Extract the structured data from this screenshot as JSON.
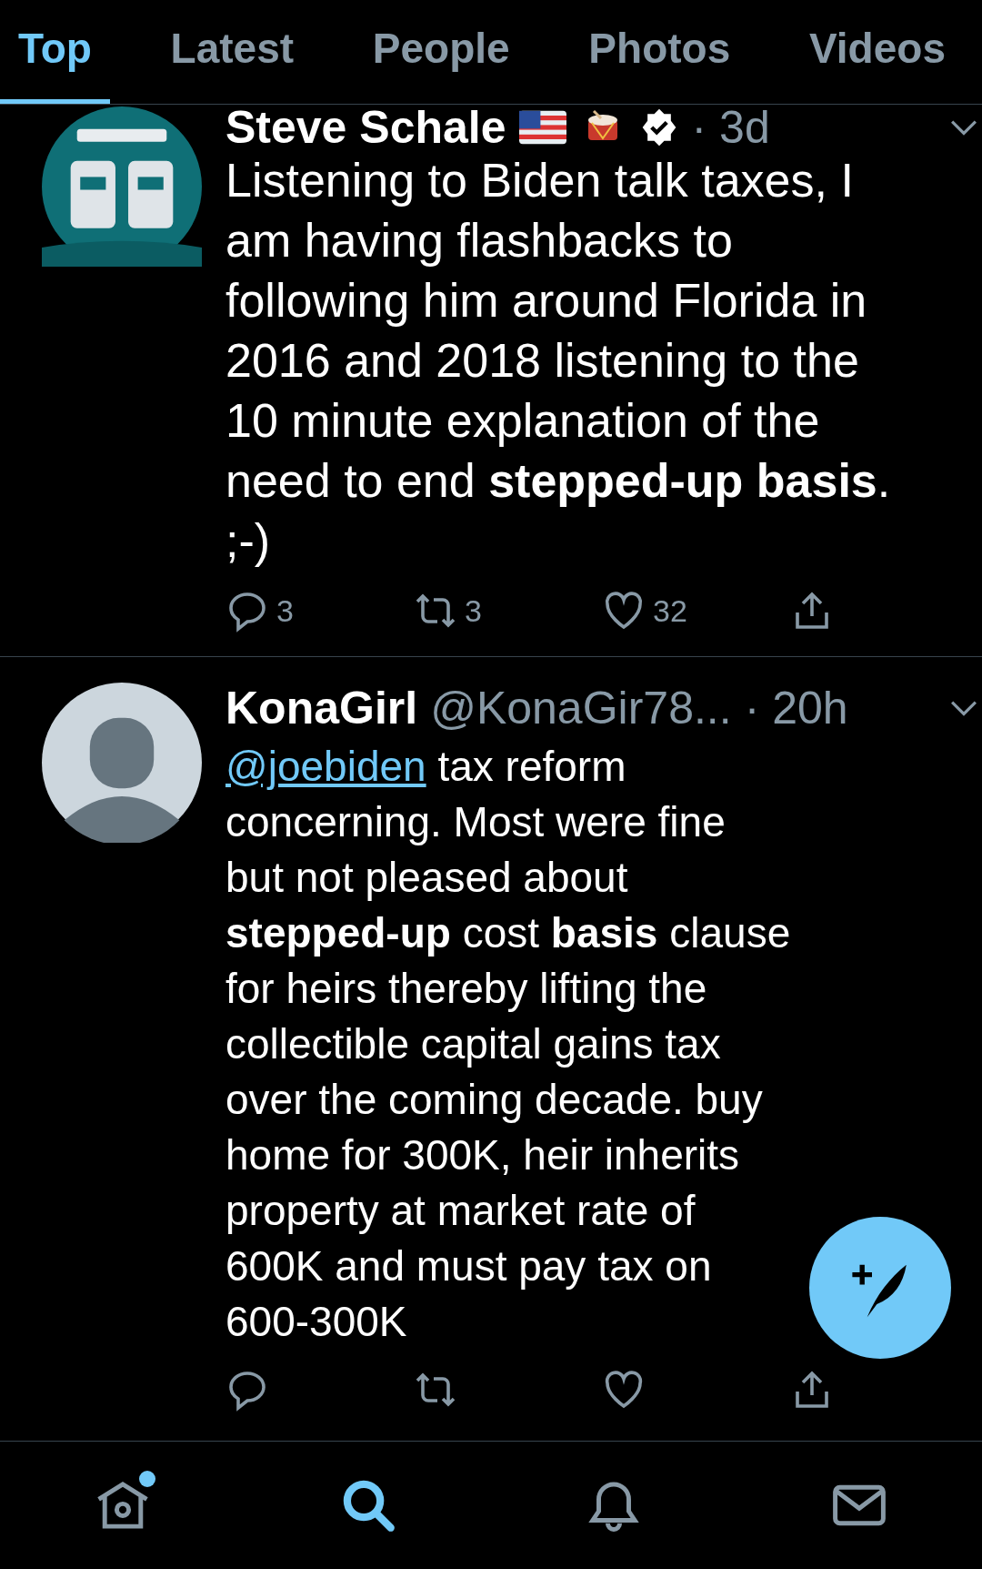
{
  "tabs": [
    {
      "label": "Top",
      "selected": true
    },
    {
      "label": "Latest",
      "selected": false
    },
    {
      "label": "People",
      "selected": false
    },
    {
      "label": "Photos",
      "selected": false
    },
    {
      "label": "Videos",
      "selected": false
    }
  ],
  "tweets": [
    {
      "name": "Steve Schale",
      "badges": [
        {
          "kind": "flag"
        },
        {
          "kind": "drum"
        }
      ],
      "verified": true,
      "time": "· 3d",
      "body": "Listening to Biden talk taxes, I am having flashbacks to following him around Florida in 2016 and 2018 listening to the 10 minute explanation of the need to end **stepped-up basis**. ;-)",
      "replies": "3",
      "retweets": "3",
      "likes": "32"
    },
    {
      "avatar": {
        "kind": "default"
      },
      "name": "KonaGirl",
      "handle": "@KonaGir78...",
      "verified": false,
      "time": "· 20h",
      "mention": "@joebiden",
      "body": "tax reform concerning. Most were fine but not pleased about **stepped-up** cost **basis** clause for heirs thereby lifting the collectible capital gains tax over the coming decade. buy home for 300K, heir inherits property at market rate of 600K and must pay tax on 600-300K"
    }
  ],
  "nav": [
    {
      "kind": "home",
      "selected": false,
      "badge": true
    },
    {
      "kind": "search",
      "selected": true,
      "badge": false
    },
    {
      "kind": "notifications",
      "selected": false,
      "badge": false
    },
    {
      "kind": "messages",
      "selected": false,
      "badge": false
    }
  ]
}
